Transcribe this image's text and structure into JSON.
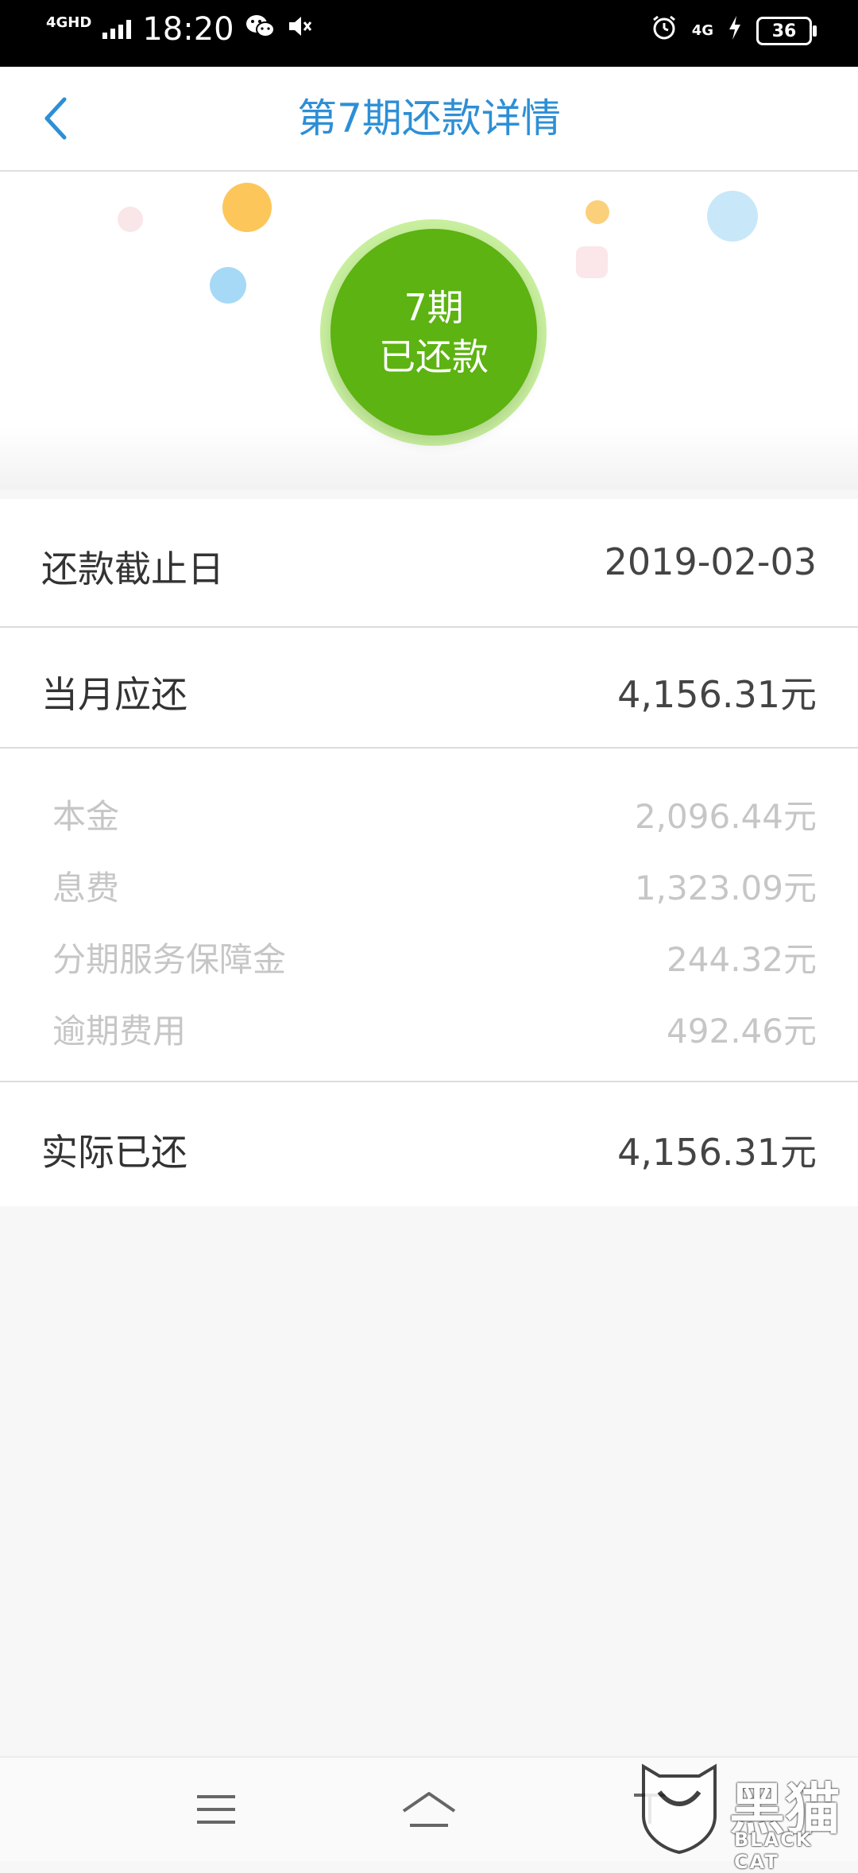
{
  "status_bar": {
    "network": "4GHD",
    "time": "18:20",
    "mobile_data": "4G",
    "battery": "36"
  },
  "header": {
    "title": "第7期还款详情"
  },
  "hero": {
    "period_label": "7期",
    "status_label": "已还款",
    "colors": {
      "circle": "#5cb311",
      "accent_blue": "#2d8fd6"
    }
  },
  "details": {
    "due_date_label": "还款截止日",
    "due_date_value": "2019-02-03",
    "monthly_due_label": "当月应还",
    "monthly_due_value": "4,156.31元",
    "breakdown": [
      {
        "label": "本金",
        "value": "2,096.44元"
      },
      {
        "label": "息费",
        "value": "1,323.09元"
      },
      {
        "label": "分期服务保障金",
        "value": "244.32元"
      },
      {
        "label": "逾期费用",
        "value": "492.46元"
      }
    ],
    "actual_paid_label": "实际已还",
    "actual_paid_value": "4,156.31元"
  },
  "nav": {
    "items": [
      "menu-icon",
      "home-icon",
      "back-icon"
    ]
  },
  "watermark": {
    "text": "黑猫",
    "sub": "BLACK CAT"
  }
}
